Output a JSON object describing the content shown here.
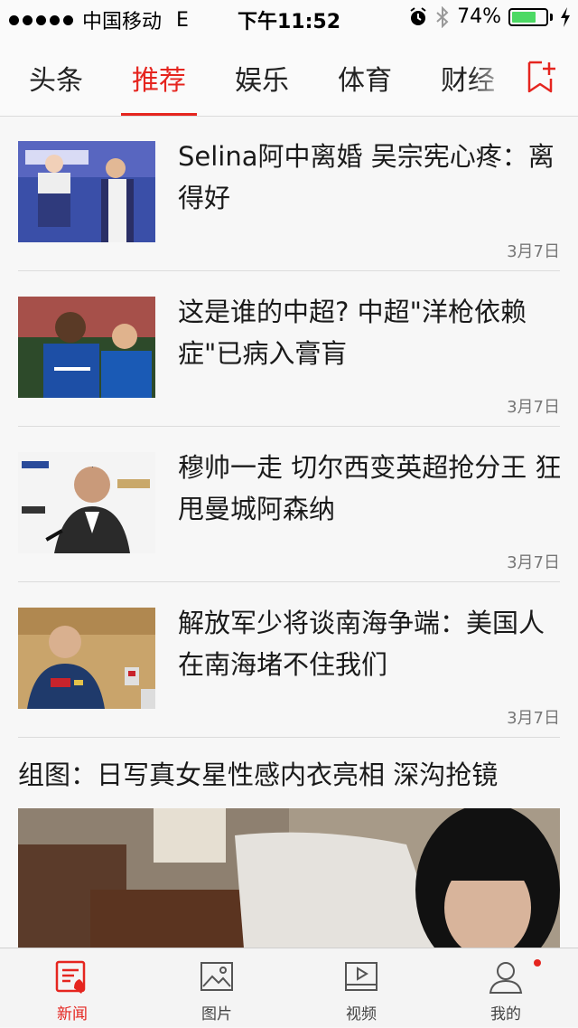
{
  "status_bar": {
    "carrier": "中国移动",
    "network": "E",
    "time": "下午11:52",
    "battery_percent": "74%",
    "battery_level": 0.74,
    "icons": [
      "signal-dots-icon",
      "alarm-icon",
      "bluetooth-icon",
      "battery-icon",
      "charging-bolt-icon"
    ]
  },
  "tabs": [
    {
      "label": "头条",
      "active": false
    },
    {
      "label": "推荐",
      "active": true
    },
    {
      "label": "娱乐",
      "active": false
    },
    {
      "label": "体育",
      "active": false
    },
    {
      "label": "财经",
      "active": false
    }
  ],
  "tab_add_icon": "bookmark-plus-icon",
  "news": [
    {
      "title": "Selina阿中离婚 吴宗宪心疼：离得好",
      "date": "3月7日"
    },
    {
      "title": "这是谁的中超? 中超\"洋枪依赖症\"已病入膏肓",
      "date": "3月7日"
    },
    {
      "title": "穆帅一走 切尔西变英超抢分王 狂甩曼城阿森纳",
      "date": "3月7日"
    },
    {
      "title": "解放军少将谈南海争端：美国人在南海堵不住我们",
      "date": "3月7日"
    }
  ],
  "gallery": {
    "title": "组图：日写真女星性感内衣亮相 深沟抢镜"
  },
  "bottom_nav": [
    {
      "label": "新闻",
      "icon": "news-icon",
      "active": true
    },
    {
      "label": "图片",
      "icon": "picture-icon",
      "active": false
    },
    {
      "label": "视频",
      "icon": "video-icon",
      "active": false
    },
    {
      "label": "我的",
      "icon": "profile-icon",
      "active": false
    }
  ],
  "colors": {
    "accent": "#e5251f",
    "battery": "#4cd964"
  }
}
